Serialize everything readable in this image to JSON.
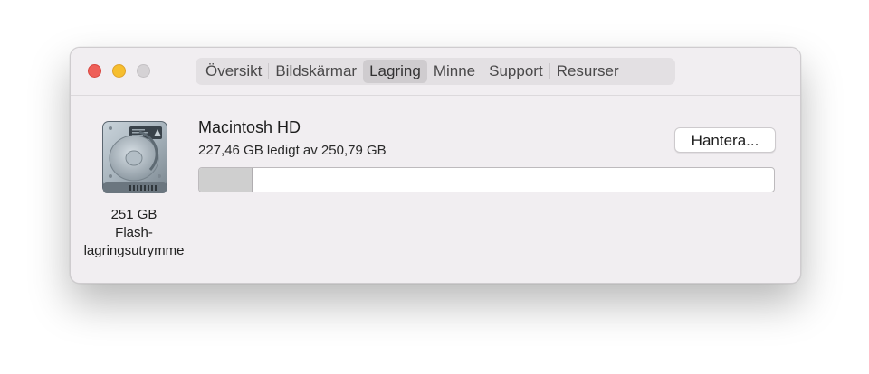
{
  "window": {
    "tabs": [
      {
        "label": "Översikt",
        "active": false
      },
      {
        "label": "Bildskärmar",
        "active": false
      },
      {
        "label": "Lagring",
        "active": true
      },
      {
        "label": "Minne",
        "active": false
      },
      {
        "label": "Support",
        "active": false
      },
      {
        "label": "Resurser",
        "active": false
      }
    ]
  },
  "disk": {
    "icon": "hard-drive-icon",
    "size": "251 GB",
    "type_line1": "Flash-",
    "type_line2": "lagringsutrymme"
  },
  "volume": {
    "name": "Macintosh HD",
    "detail": "227,46 GB ledigt av 250,79 GB",
    "used_fraction": 0.093
  },
  "actions": {
    "manage_label": "Hantera..."
  },
  "colors": {
    "close": "#ee5f58",
    "minimize": "#f6be2e",
    "zoom_disabled": "#d5d2d5",
    "used_segment": "#cfcfcf"
  }
}
